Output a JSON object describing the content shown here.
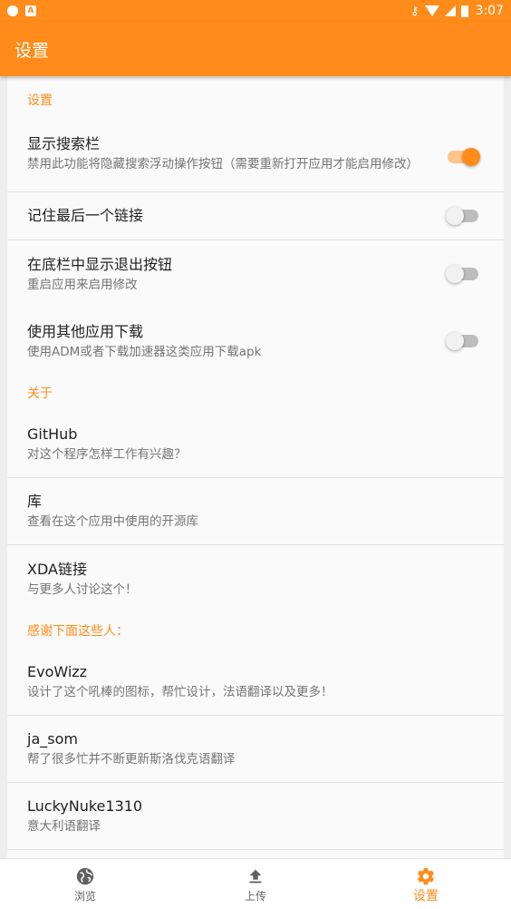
{
  "status_bar": {
    "time": "3:07",
    "icons": [
      "circle-icon",
      "a-icon",
      "key-icon",
      "wifi-icon",
      "signal-icon",
      "battery-icon"
    ]
  },
  "app_bar": {
    "title": "设置"
  },
  "sections": {
    "settings": {
      "header": "设置",
      "search_bar": {
        "title": "显示搜索栏",
        "summary": "禁用此功能将隐藏搜索浮动操作按钮（需要重新打开应用才能启用修改）",
        "enabled": true
      },
      "remember_link": {
        "title": "记住最后一个链接",
        "enabled": false
      },
      "exit_button": {
        "title": "在底栏中显示退出按钮",
        "summary": "重启应用来启用修改",
        "enabled": false
      },
      "other_downloader": {
        "title": "使用其他应用下载",
        "summary": "使用ADM或者下载加速器这类应用下载apk",
        "enabled": false
      }
    },
    "about": {
      "header": "关于",
      "github": {
        "title": "GitHub",
        "summary": "对这个程序怎样工作有兴趣？"
      },
      "libraries": {
        "title": "库",
        "summary": "查看在这个应用中使用的开源库"
      },
      "xda": {
        "title": "XDA链接",
        "summary": "与更多人讨论这个！"
      }
    },
    "thanks": {
      "header": "感谢下面这些人：",
      "people": [
        {
          "name": "EvoWizz",
          "summary": "设计了这个吼棒的图标，帮忙设计，法语翻译以及更多！"
        },
        {
          "name": "ja_som",
          "summary": "帮了很多忙并不断更新斯洛伐克语翻译"
        },
        {
          "name": "LuckyNuke1310",
          "summary": "意大利语翻译"
        }
      ]
    }
  },
  "bottom_nav": {
    "items": [
      {
        "label": "浏览",
        "icon": "globe-icon",
        "active": false
      },
      {
        "label": "上传",
        "icon": "upload-icon",
        "active": false
      },
      {
        "label": "设置",
        "icon": "gear-icon",
        "active": true
      }
    ]
  },
  "colors": {
    "accent": "#ff8c1a",
    "text_primary": "#212121",
    "text_secondary": "#757575"
  }
}
